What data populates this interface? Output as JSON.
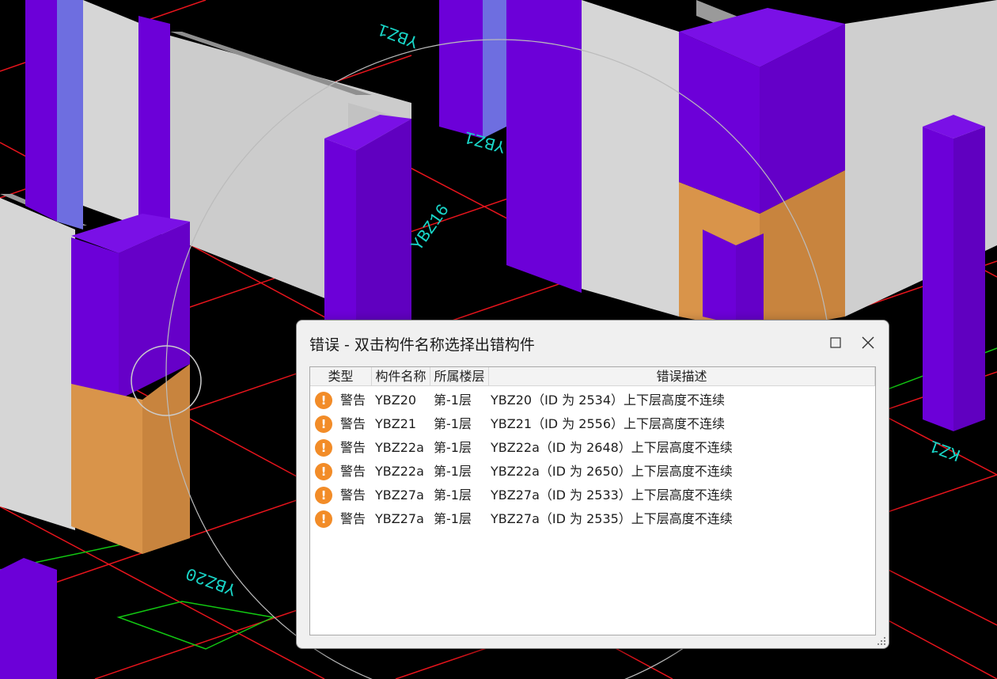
{
  "dialog": {
    "title": "错误 - 双击构件名称选择出错构件",
    "maximize_icon": "maximize-icon",
    "close_icon": "close-icon",
    "columns": [
      "类型",
      "构件名称",
      "所属楼层",
      "错误描述"
    ],
    "rows": [
      {
        "type": "警告",
        "name": "YBZ20",
        "floor": "第-1层",
        "description": "YBZ20（ID 为 2534）上下层高度不连续"
      },
      {
        "type": "警告",
        "name": "YBZ21",
        "floor": "第-1层",
        "description": "YBZ21（ID 为 2556）上下层高度不连续"
      },
      {
        "type": "警告",
        "name": "YBZ22a",
        "floor": "第-1层",
        "description": "YBZ22a（ID 为 2648）上下层高度不连续"
      },
      {
        "type": "警告",
        "name": "YBZ22a",
        "floor": "第-1层",
        "description": "YBZ22a（ID 为 2650）上下层高度不连续"
      },
      {
        "type": "警告",
        "name": "YBZ27a",
        "floor": "第-1层",
        "description": "YBZ27a（ID 为 2533）上下层高度不连续"
      },
      {
        "type": "警告",
        "name": "YBZ27a",
        "floor": "第-1层",
        "description": "YBZ27a（ID 为 2535）上下层高度不连续"
      }
    ],
    "row_icon": "warning-icon"
  },
  "scene": {
    "labels": [
      "YBZ1",
      "YBZ1",
      "YBZ16",
      "KZ1",
      "YBZ20"
    ],
    "colors": {
      "background": "#000000",
      "grid": "#e8141c",
      "column": "#6c00d8",
      "wall": "#d3d3d3",
      "highlight": "#d9944a",
      "label": "#19d6c8"
    }
  }
}
